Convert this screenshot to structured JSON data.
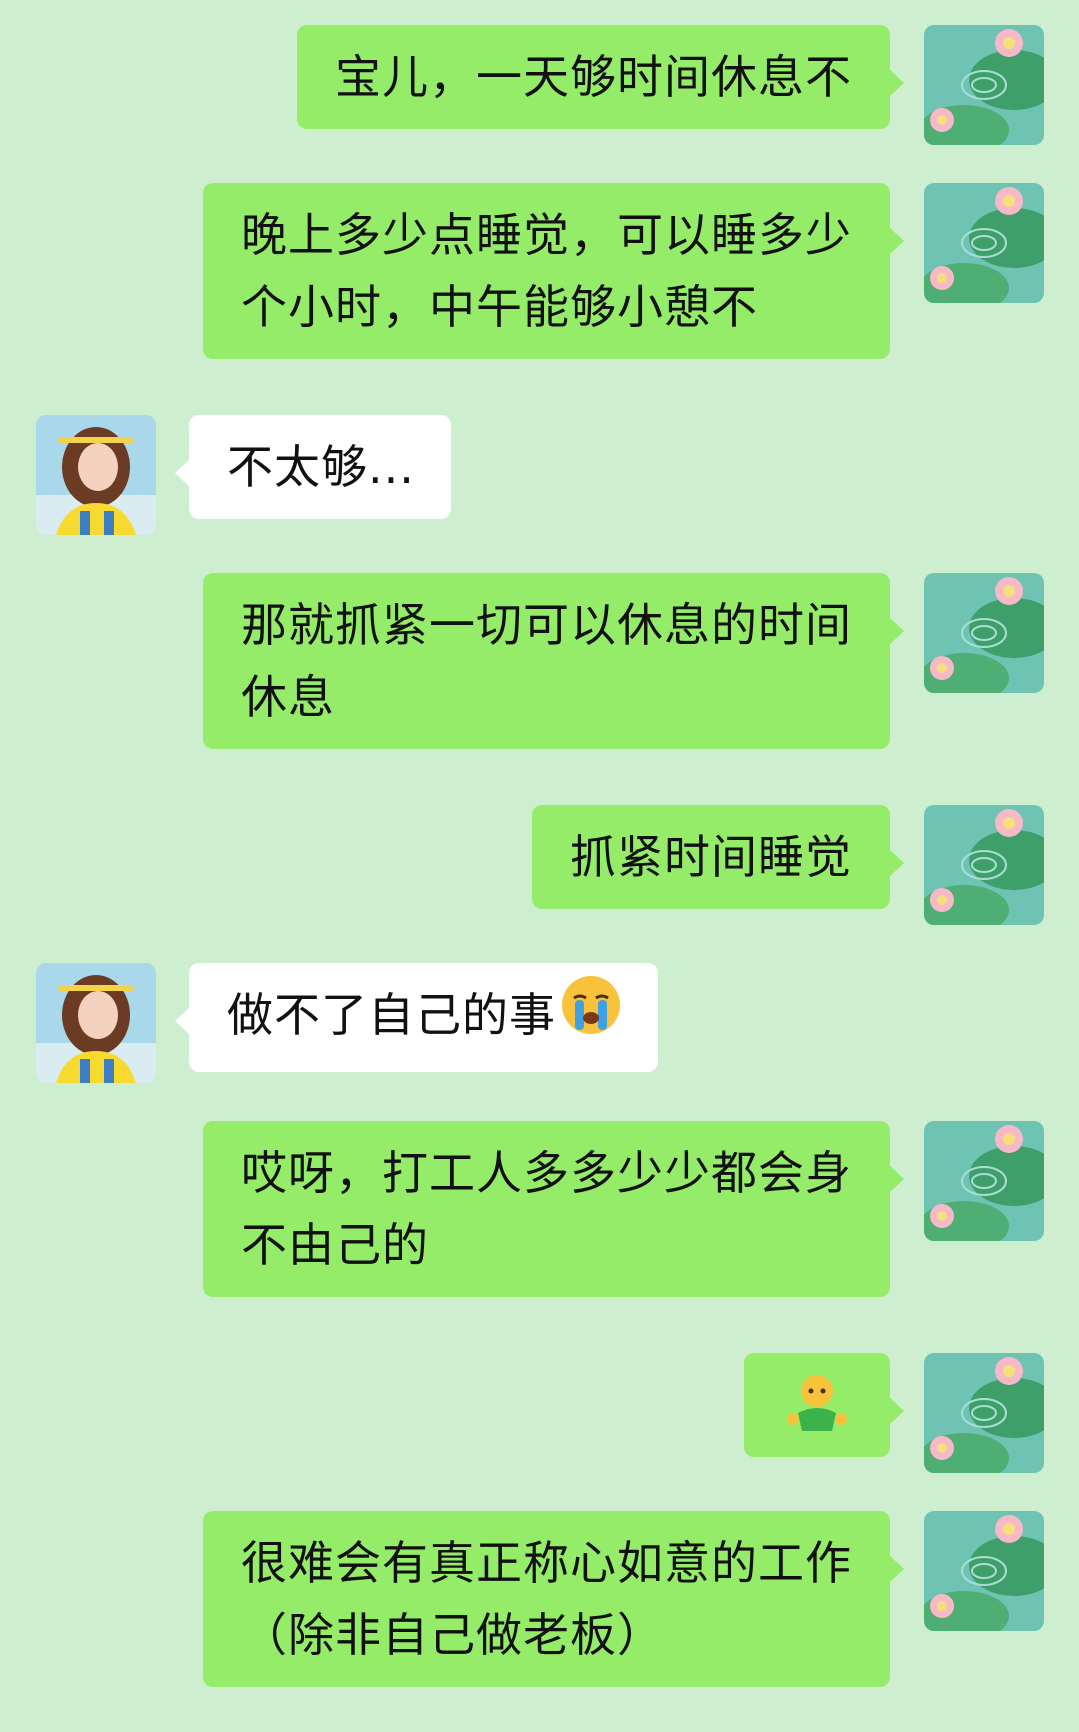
{
  "colors": {
    "background": "#cdeecf",
    "self_bubble": "#95ec69",
    "other_bubble": "#ffffff",
    "text": "#111111"
  },
  "self_avatar_icon": "lotus-pond-avatar",
  "other_avatar_icon": "girl-yellow-shirt-avatar",
  "messages": [
    {
      "sender": "self",
      "text": "宝儿，一天够时间休息不"
    },
    {
      "sender": "self",
      "text": "晚上多少点睡觉，可以睡多少\n个小时，中午能够小憩不"
    },
    {
      "sender": "other",
      "text": "不太够..."
    },
    {
      "sender": "self",
      "text": "那就抓紧一切可以休息的时间\n休息"
    },
    {
      "sender": "self",
      "text": "抓紧时间睡觉"
    },
    {
      "sender": "other",
      "text": "做不了自己的事",
      "emoji": "crying-face-emoji"
    },
    {
      "sender": "self",
      "text": "哎呀，打工人多多少少都会身\n不由己的"
    },
    {
      "sender": "self",
      "text": "",
      "emoji": "shrug-figure-emoji"
    },
    {
      "sender": "self",
      "text": "很难会有真正称心如意的工作\n（除非自己做老板）"
    }
  ]
}
